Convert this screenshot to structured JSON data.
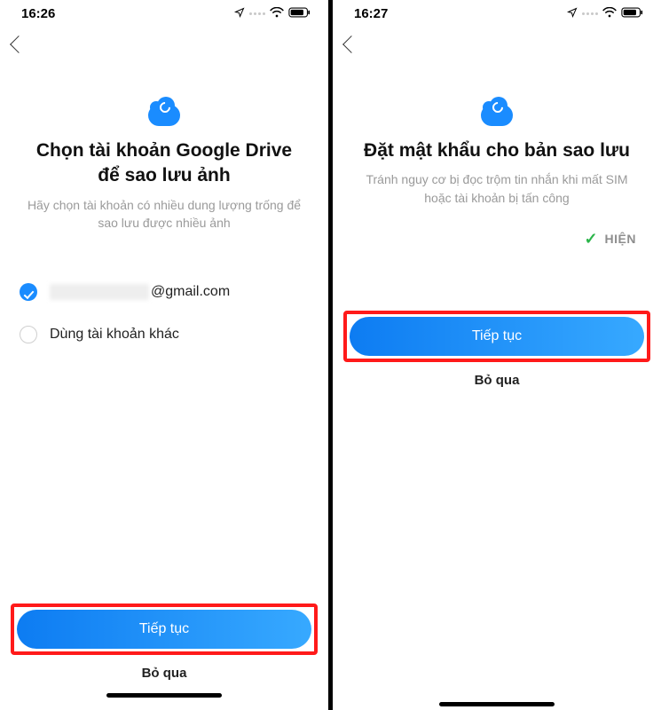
{
  "left": {
    "statusbar": {
      "time": "16:26"
    },
    "title": "Chọn tài khoản Google Drive để sao lưu ảnh",
    "subtitle": "Hãy chọn tài khoản có nhiều dung lượng trống để sao lưu được nhiều ảnh",
    "accounts": [
      {
        "display_suffix": "@gmail.com",
        "selected": true
      },
      {
        "label": "Dùng tài khoản khác",
        "selected": false
      }
    ],
    "continue_label": "Tiếp tục",
    "skip_label": "Bỏ qua"
  },
  "right": {
    "statusbar": {
      "time": "16:27"
    },
    "title": "Đặt mật khẩu cho bản sao lưu",
    "subtitle": "Tránh nguy cơ bị đọc trộm tin nhắn khi mất SIM hoặc tài khoản bị tấn công",
    "password_visibility_label": "HIỆN",
    "continue_label": "Tiếp tục",
    "skip_label": "Bỏ qua"
  },
  "colors": {
    "primary": "#1a8cff",
    "highlight_border": "#ff1a1a",
    "check_green": "#2bb54a"
  }
}
